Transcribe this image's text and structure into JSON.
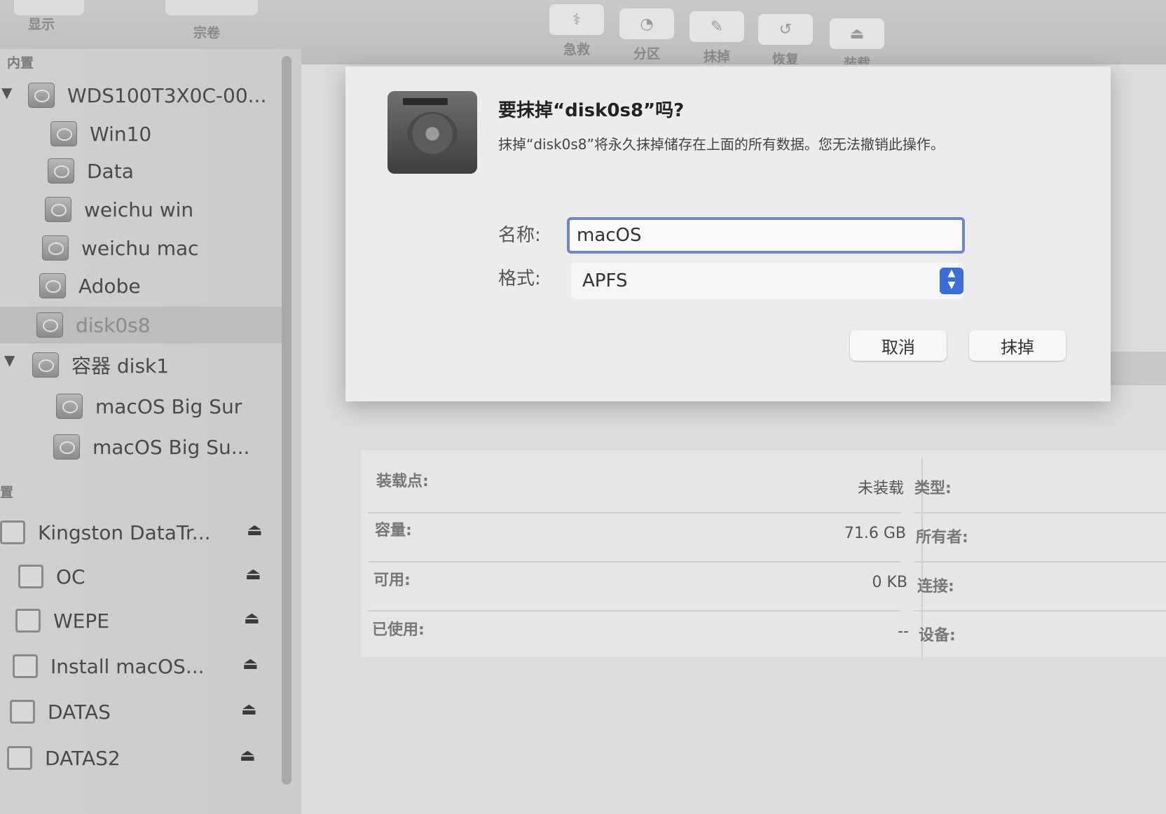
{
  "toolbar": {
    "left_items": [
      {
        "label": "显示"
      },
      {
        "label": "宗卷"
      }
    ],
    "actions": [
      {
        "label": "急救",
        "icon": "stethoscope-icon",
        "glyph": "⚕"
      },
      {
        "label": "分区",
        "icon": "partition-icon",
        "glyph": "◔"
      },
      {
        "label": "抹掉",
        "icon": "erase-icon",
        "glyph": "✎"
      },
      {
        "label": "恢复",
        "icon": "restore-icon",
        "glyph": "↺"
      },
      {
        "label": "装载",
        "icon": "mount-icon",
        "glyph": "⏏"
      }
    ]
  },
  "sidebar": {
    "internal_header": "内置",
    "external_header": "置",
    "internal": [
      {
        "label": "WDS100T3X0C-00...",
        "level": 0,
        "expanded": true
      },
      {
        "label": "Win10",
        "level": 1
      },
      {
        "label": "Data",
        "level": 1
      },
      {
        "label": "weichu win",
        "level": 1
      },
      {
        "label": "weichu mac",
        "level": 1
      },
      {
        "label": "Adobe",
        "level": 1
      },
      {
        "label": "disk0s8",
        "level": 1,
        "selected": true
      },
      {
        "label": "容器 disk1",
        "level": 0,
        "expanded": true
      },
      {
        "label": "macOS Big Sur",
        "level": 2
      },
      {
        "label": "macOS Big Su...",
        "level": 2
      }
    ],
    "external": [
      {
        "label": "Kingston DataTr..."
      },
      {
        "label": "OC"
      },
      {
        "label": "WEPE"
      },
      {
        "label": "Install macOS..."
      },
      {
        "label": "DATAS"
      },
      {
        "label": "DATAS2"
      }
    ],
    "eject_glyph": "⏏"
  },
  "dialog": {
    "title": "要抹掉“disk0s8”吗?",
    "message": "抹掉“disk0s8”将永久抹掉储存在上面的所有数据。您无法撤销此操作。",
    "name_label": "名称:",
    "name_value": "macOS",
    "format_label": "格式:",
    "format_value": "APFS",
    "cancel_label": "取消",
    "erase_label": "抹掉",
    "stepper_glyph": "▲▼"
  },
  "info": {
    "left": [
      {
        "label": "装载点:",
        "value": "未装载"
      },
      {
        "label": "容量:",
        "value": "71.6 GB"
      },
      {
        "label": "可用:",
        "value": "0 KB"
      },
      {
        "label": "已使用:",
        "value": "--"
      }
    ],
    "right": [
      {
        "label": "类型:"
      },
      {
        "label": "所有者:"
      },
      {
        "label": "连接:"
      },
      {
        "label": "设备:"
      }
    ]
  }
}
